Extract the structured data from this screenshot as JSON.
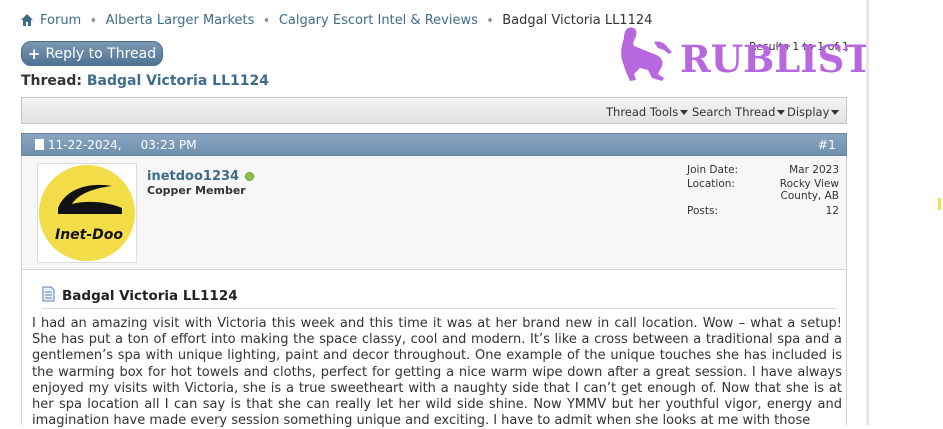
{
  "breadcrumb": {
    "home_icon": "home-icon",
    "items": [
      "Forum",
      "Alberta Larger Markets",
      "Calgary Escort Intel & Reviews"
    ],
    "current": "Badgal Victoria LL1124",
    "separator": "➧"
  },
  "reply_button": {
    "label": "Reply to Thread",
    "plus": "+"
  },
  "results": "Results 1 to 1 of 1",
  "logo": {
    "text": "RUBLIST.COM",
    "color": "#b868de"
  },
  "thread": {
    "prefix": "Thread:",
    "title": "Badgal Victoria LL1124"
  },
  "tools": [
    "Thread Tools",
    "Search Thread",
    "Display"
  ],
  "post": {
    "date": "11-22-2024,",
    "time": "03:23 PM",
    "number": "#1",
    "username": "inetdoo1234",
    "user_title": "Copper Member",
    "avatar_text": "Inet-Doo",
    "stats": [
      {
        "label": "Join Date:",
        "value": "Mar 2023"
      },
      {
        "label": "Location:",
        "value": "Rocky View County, AB"
      },
      {
        "label": "Posts:",
        "value": "12"
      }
    ],
    "title": "Badgal Victoria LL1124",
    "body": "I had an amazing visit with Victoria this week and this time it was at her brand new in call location. Wow – what a setup! She has put a ton of effort into making the space classy, cool and modern. It’s like a cross between a traditional spa and a gentlemen’s spa with unique lighting, paint and decor throughout. One example of the unique touches she has included is the warming box for hot towels and cloths, perfect for getting a nice warm wipe down after a great session. I have always enjoyed my visits with Victoria, she is a true sweetheart with a naughty side that I can’t get enough of. Now that she is at her spa location all I can say is that she can really let her wild side shine. Now YMMV but her youthful vigor, energy and imagination have made every session something unique and exciting. I have to admit when she looks at me with those"
  },
  "colors": {
    "link": "#3e6d8c",
    "post_header": "#7b99b6",
    "avatar_yellow": "#f2dc48",
    "online": "#8bc34a"
  }
}
